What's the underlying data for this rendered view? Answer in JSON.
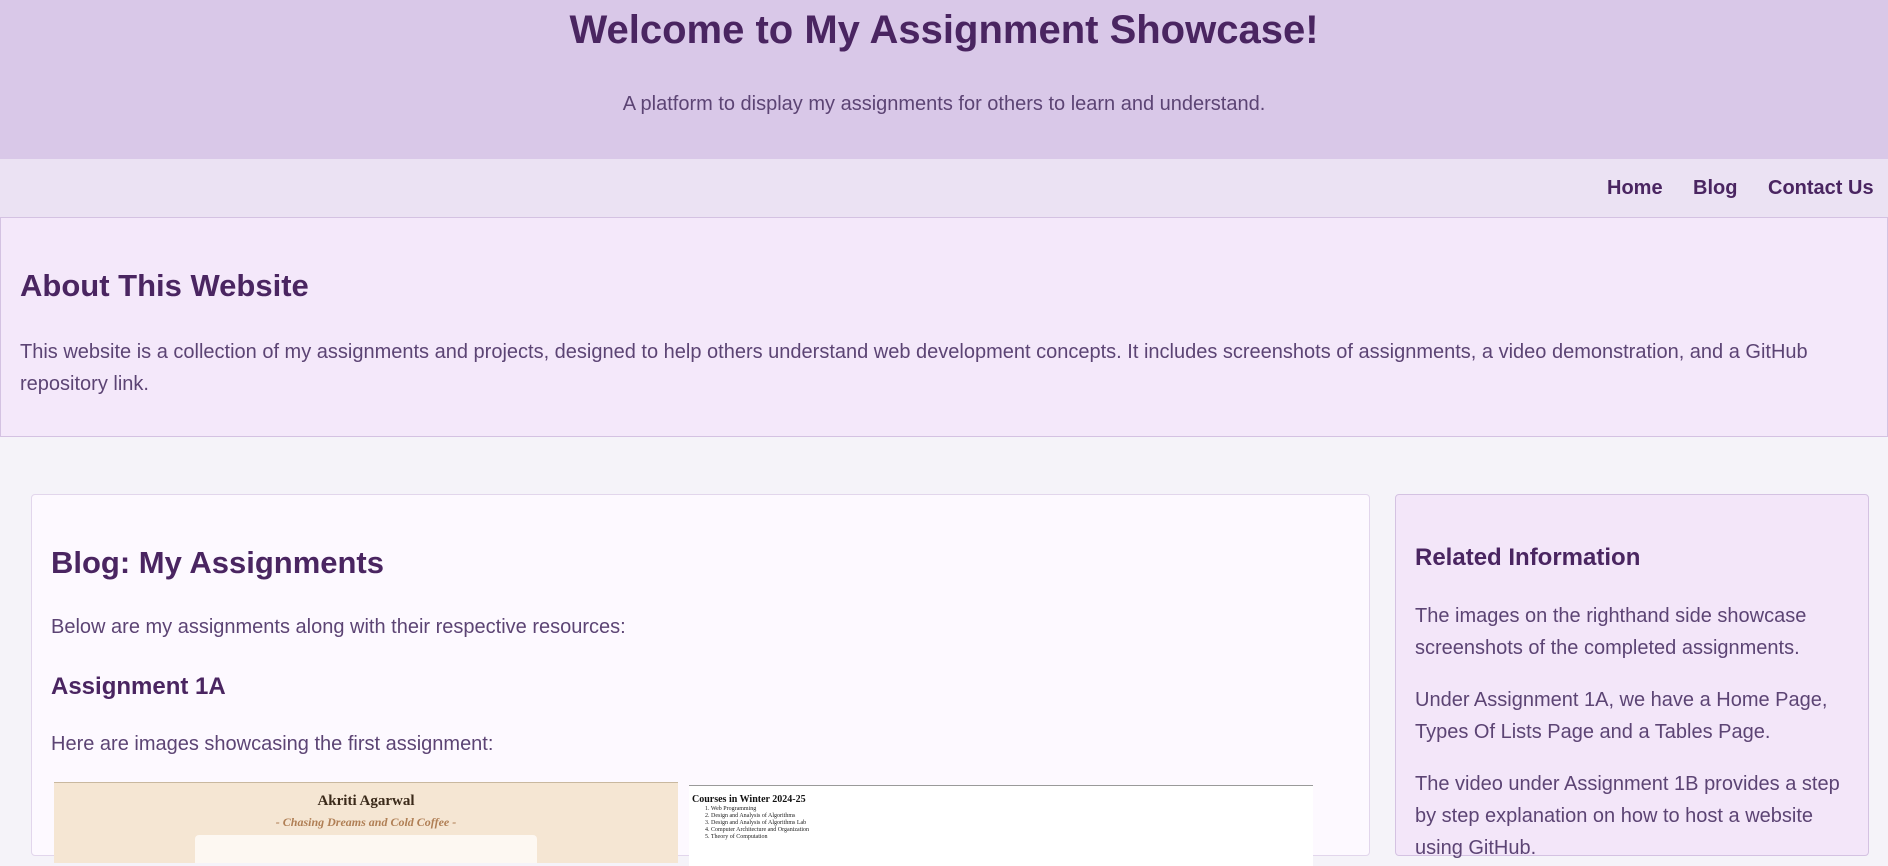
{
  "header": {
    "title": "Welcome to My Assignment Showcase!",
    "subtitle": "A platform to display my assignments for others to learn and understand."
  },
  "nav": {
    "items": [
      "Home",
      "Blog",
      "Contact Us"
    ]
  },
  "about": {
    "heading": "About This Website",
    "text": "This website is a collection of my assignments and projects, designed to help others understand web development concepts. It includes screenshots of assignments, a video demonstration, and a GitHub repository link."
  },
  "blog": {
    "heading": "Blog: My Assignments",
    "intro": "Below are my assignments along with their respective resources:",
    "assignment_title": "Assignment 1A",
    "assignment_desc": "Here are images showcasing the first assignment:",
    "screenshot1": {
      "name": "Akriti Agarwal",
      "tagline": "- Chasing Dreams and Cold Coffee -"
    },
    "screenshot2": {
      "title": "Courses in Winter 2024-25",
      "courses": [
        "1. Web Programming",
        "2. Design and Analysis of Algorithms",
        "3. Design and Analysis of Algorithms Lab",
        "4. Computer Architecture and Organization",
        "5. Theory of Computation"
      ]
    }
  },
  "sidebar": {
    "heading": "Related Information",
    "paragraphs": [
      "The images on the righthand side showcase screenshots of the completed assignments.",
      "Under Assignment 1A, we have a Home Page, Types Of Lists Page and a Tables Page.",
      "The video under Assignment 1B provides a step by step explanation on how to host a website using GitHub."
    ]
  }
}
